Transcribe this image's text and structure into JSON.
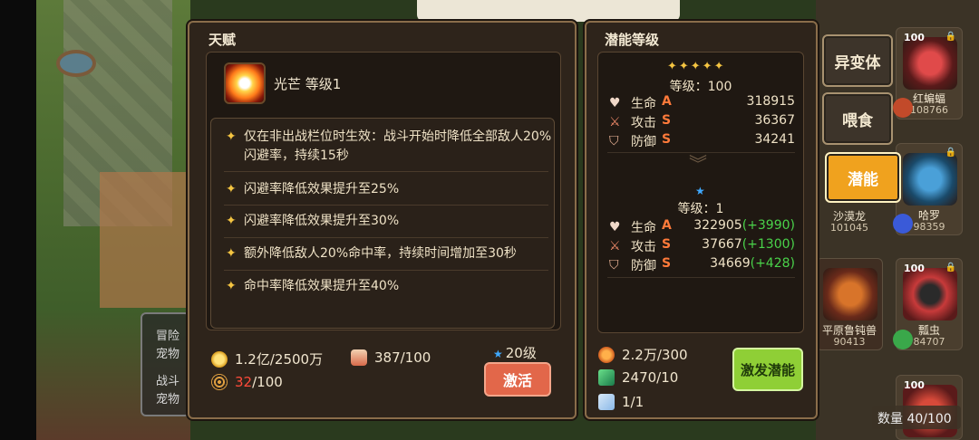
{
  "side_tabs": [
    {
      "label": "异变体",
      "active": false
    },
    {
      "label": "喂食",
      "active": false
    },
    {
      "label": "潜能",
      "active": true
    }
  ],
  "background_left_panel": {
    "lines": [
      "冒险",
      "宠物",
      "战斗",
      "宠物"
    ]
  },
  "pet_list": [
    {
      "level": "100",
      "name": "",
      "power": ""
    },
    {
      "level": "",
      "name": "红蝙蝠",
      "power": "108766"
    },
    {
      "level": "",
      "name": "沙漠龙",
      "power": "101045"
    },
    {
      "level": "",
      "name": "哈罗",
      "power": "98359"
    },
    {
      "level": "",
      "name": "平原鲁钝兽",
      "power": "90413"
    },
    {
      "level": "100",
      "name": "瓢虫",
      "power": "84707"
    },
    {
      "level": "100",
      "name": "",
      "power": ""
    }
  ],
  "pet_quantity": "数量 40/100",
  "talent": {
    "title": "天赋",
    "name": "光芒 等级1",
    "effects": [
      "仅在非出战栏位时生效：战斗开始时降低全部敌人20%闪避率，持续15秒",
      "闪避率降低效果提升至25%",
      "闪避率降低效果提升至30%",
      "额外降低敌人20%命中率，持续时间增加至30秒",
      "命中率降低效果提升至40%"
    ],
    "gold": "1.2亿/2500万",
    "potion": "387/100",
    "web_have": "32",
    "web_need": "/100",
    "required_level": "20级",
    "activate_label": "激活"
  },
  "potential": {
    "title": "潜能等级",
    "current_level": "等级：100",
    "next_level": "等级：1",
    "current_stats": [
      {
        "label": "生命",
        "grade": "A",
        "value": "318915"
      },
      {
        "label": "攻击",
        "grade": "S",
        "value": "36367"
      },
      {
        "label": "防御",
        "grade": "S",
        "value": "34241"
      }
    ],
    "next_stats": [
      {
        "label": "生命",
        "grade": "A",
        "value": "322905",
        "bonus": "(+3990)"
      },
      {
        "label": "攻击",
        "grade": "S",
        "value": "37667",
        "bonus": "(+1300)"
      },
      {
        "label": "防御",
        "grade": "S",
        "value": "34669",
        "bonus": "(+428)"
      }
    ],
    "materials": [
      "2.2万/300",
      "2470/10",
      "1/1"
    ],
    "awaken_label": "激发潜能"
  },
  "colors": {
    "accent_orange": "#f0a21e",
    "activate": "#e2674a",
    "awaken": "#8fcf36",
    "bonus_green": "#4ad24a",
    "grade": "#ff7a3a"
  }
}
